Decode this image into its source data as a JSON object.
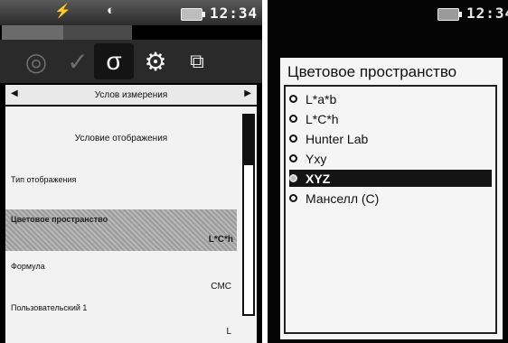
{
  "left_screen": {
    "status": {
      "time": "12:34"
    },
    "nav_title": "Услов измерения",
    "panel_title": "Условие отображения",
    "rows": [
      {
        "label": "Тип отображения",
        "value": ""
      },
      {
        "label": "Цветовое пространство",
        "value": "L*C*h"
      },
      {
        "label": "Формула",
        "value": "CMC"
      },
      {
        "label": "Пользовательский 1",
        "value": "L"
      }
    ]
  },
  "right_screen": {
    "status": {
      "time": "12:34"
    },
    "dialog_title": "Цветовое пространство",
    "options": [
      "L*a*b",
      "L*C*h",
      "Hunter Lab",
      "Yxy",
      "XYZ",
      "Манселл (C)"
    ],
    "selected_option": "XYZ"
  }
}
